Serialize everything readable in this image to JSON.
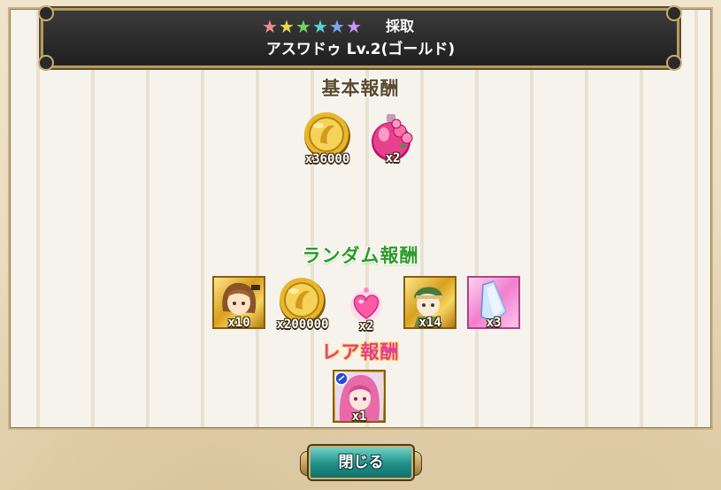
{
  "header": {
    "stars": [
      {
        "glyph": "★",
        "color": "#f08c8c"
      },
      {
        "glyph": "★",
        "color": "#e8d84a"
      },
      {
        "glyph": "★",
        "color": "#6fd36a"
      },
      {
        "glyph": "★",
        "color": "#5ad0d8"
      },
      {
        "glyph": "★",
        "color": "#7aa8f0"
      },
      {
        "glyph": "★",
        "color": "#c79af0"
      }
    ],
    "category": "採取",
    "title": "アスワドゥ Lv.2(ゴールド)"
  },
  "sections": {
    "basic": {
      "title": "基本報酬",
      "items": [
        {
          "icon": "gold-coin-icon",
          "qty": "x36000"
        },
        {
          "icon": "rose-potion-icon",
          "qty": "x2"
        }
      ]
    },
    "random": {
      "title": "ランダム報酬",
      "items": [
        {
          "icon": "girl-character-card-icon",
          "qty": "x10"
        },
        {
          "icon": "gold-coin-icon",
          "qty": "x200000"
        },
        {
          "icon": "pink-heart-icon",
          "qty": "x2"
        },
        {
          "icon": "green-hat-character-card-icon",
          "qty": "x14"
        },
        {
          "icon": "crystal-card-icon",
          "qty": "x3"
        }
      ]
    },
    "rare": {
      "title": "レア報酬",
      "items": [
        {
          "icon": "pink-hair-character-card-icon",
          "qty": "x1"
        }
      ]
    }
  },
  "close_button": {
    "label": "閉じる"
  },
  "colors": {
    "header_bg": "#2a2a2a",
    "header_border": "#b59a5e",
    "random_title": "#2f9a2a",
    "rare_title": "#e23aa0",
    "button": "#1f8f8a"
  }
}
